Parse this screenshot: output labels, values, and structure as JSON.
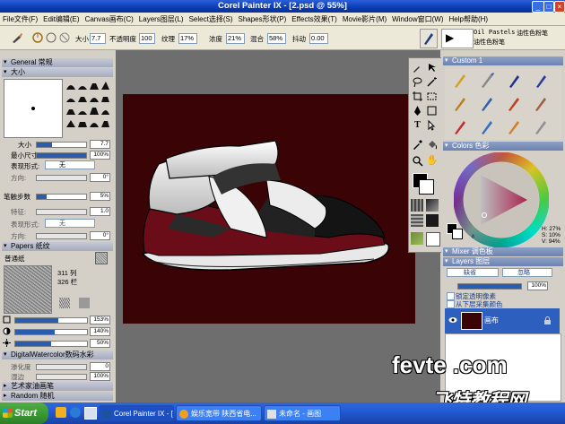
{
  "window": {
    "title": "Corel Painter IX - [2.psd @ 55%]"
  },
  "menu": [
    "File文件(F)",
    "Edit编辑(E)",
    "Canvas画布(C)",
    "Layers图层(L)",
    "Select选择(S)",
    "Shapes形状(P)",
    "Effects效果(T)",
    "Movie影片(M)",
    "Window窗口(W)",
    "Help帮助(H)"
  ],
  "property_bar": {
    "size_label": "大小",
    "size_value": "7.7",
    "opacity_label": "不透明度",
    "opacity_value": "100",
    "grain_label": "纹理",
    "grain_value": "17%",
    "resat_label": "浓度",
    "resat_value": "21%",
    "bleed_label": "混合",
    "bleed_value": "58%",
    "jitter_label": "抖动",
    "jitter_value": "0.00",
    "brush_category": "Oil Pastels",
    "brush_category_cn": "油性色粉笔",
    "brush_variant": "油性色粉笔"
  },
  "left_panel": {
    "general_header": "General 常规",
    "size_header": "大小",
    "size_label": "大小",
    "size_value": "7.7",
    "min_size_label": "最小尺寸",
    "min_size_value": "100%",
    "expression_label": "表现形式:",
    "expression_value": "无",
    "direction_label": "方向:",
    "direction_value": "0°",
    "stroke_steps_label": "笔触步数",
    "stroke_steps_value": "5%",
    "feature_label": "特征:",
    "feature_value": "1.0",
    "expression2_label": "表现形式:",
    "expression2_value": "无",
    "direction2_label": "方向:",
    "direction2_value": "0°",
    "papers_header": "Papers 纸纹",
    "paper_name": "普通纸",
    "paper_cols": "311 列",
    "paper_rows": "326 栏",
    "paper_scale_value": "153%",
    "paper_contrast_value": "140%",
    "paper_brightness_value": "50%",
    "dw_header": "DigitalWatercolor数码水彩",
    "wet_label": "渗化度",
    "wet_value": "0",
    "dry_label": "湿边",
    "dry_value": "100%",
    "artist_oils_header": "艺术家油画笔",
    "random_header": "Random 随机"
  },
  "right_panel": {
    "custom_header": "Custom 1",
    "colors_header": "Colors 色彩",
    "color_readout": [
      "H: 27%",
      "S: 10%",
      "V: 94%"
    ],
    "mixer_header": "Mixer 调色板",
    "layers_header": "Layers 图层",
    "blend_mode": "缺省",
    "composite": "忽略",
    "opacity_value": "100%",
    "lock_label": "锁定透明像素",
    "sample_label": "从下层采集颜色",
    "layer_name": "画布"
  },
  "colors": {
    "canvas_bg": "#3a0305",
    "shoe_maroon": "#6a0d18",
    "accent_blue": "#2a5db0",
    "title_blue": "#0a3cb4",
    "taskbar_blue": "#245edb",
    "start_green": "#3c9a33"
  },
  "taskbar": {
    "start_label": "Start",
    "tasks": [
      "Corel Painter IX - [2...",
      "娱乐宽带 陕西省电...",
      "未命名 - 画图"
    ],
    "tray_time": ""
  },
  "watermark": {
    "site": "fevte .com",
    "brand": "飞特教程网"
  },
  "icons": [
    "brush-tool-icon",
    "lasso-icon",
    "magnifier-icon",
    "eyedropper-icon",
    "paint-bucket-icon",
    "text-tool-icon",
    "hand-icon",
    "crop-icon",
    "rectangle-select-icon",
    "pen-icon",
    "layer-eye-icon",
    "lock-icon",
    "reset-icon"
  ]
}
